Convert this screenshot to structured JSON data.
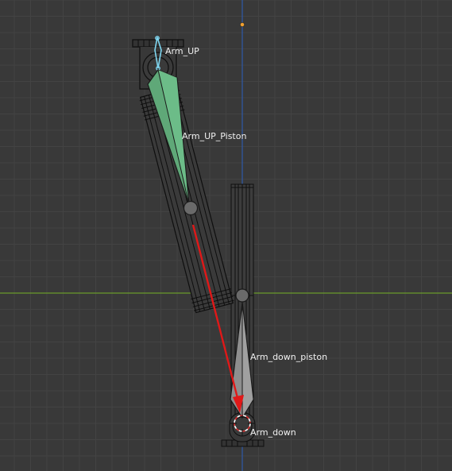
{
  "viewport": {
    "background": "#393939",
    "grid_minor_color": "#434343",
    "grid_major_color": "#4b4b4b",
    "x_axis_color": "#6a9a2a",
    "z_axis_color": "#2d5aa8",
    "origin_marker_color": "#f0a030"
  },
  "bones": {
    "arm_up": {
      "label": "Arm_UP",
      "selected_color": "#7fd6f0"
    },
    "arm_up_piston": {
      "label": "Arm_UP_Piston",
      "active_color": "#5fa878"
    },
    "arm_down_piston": {
      "label": "Arm_down_piston",
      "color": "#8e8e8e"
    },
    "arm_down": {
      "label": "Arm_down"
    }
  },
  "constraint_line": {
    "color": "#e01818"
  },
  "cursor_3d": {
    "ring_colors": [
      "#ffffff",
      "#e03030"
    ]
  }
}
